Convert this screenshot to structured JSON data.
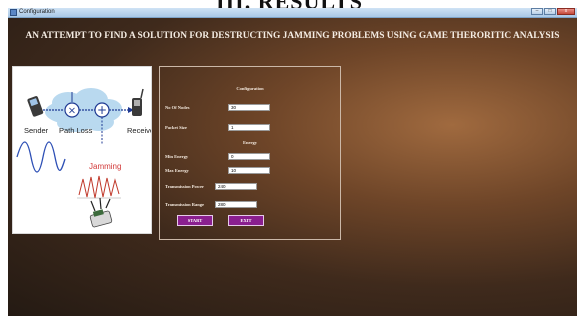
{
  "document": {
    "heading": "III. RESULTS"
  },
  "window": {
    "title": "Configuration",
    "controls": {
      "minimize": "–",
      "maximize": "□",
      "close": "x"
    }
  },
  "app": {
    "title": "AN ATTEMPT TO FIND A SOLUTION FOR DESTRUCTING JAMMING PROBLEMS USING GAME THERORITIC ANALYSIS"
  },
  "diagram": {
    "labels": {
      "sender": "Sender",
      "path_loss": "Path Loss",
      "receiver": "Receiver",
      "jamming": "Jamming"
    },
    "symbols": {
      "multiply": "×",
      "add": "+"
    }
  },
  "configuration": {
    "title": "Configuration",
    "fields": [
      {
        "label": "No Of Nodes",
        "value": "30"
      },
      {
        "label": "Packet Size",
        "value": "1"
      }
    ],
    "energy_title": "Energy",
    "energy_fields": [
      {
        "label": "Min Energy",
        "value": "0"
      },
      {
        "label": "Max Energy",
        "value": "10"
      },
      {
        "label": "Transmission Power",
        "value": "240"
      },
      {
        "label": "Transmission Range",
        "value": "280"
      }
    ],
    "buttons": {
      "start": "START",
      "exit": "EXIT"
    }
  },
  "colors": {
    "background_gradient": [
      "#a06a3f",
      "#241a13"
    ],
    "button_fill": "#8a1f8f",
    "jamming_label": "#d23a3a",
    "sender_wave": "#2d4fb5",
    "jamming_wave": "#c0392b",
    "cloud": "#b9d9ef"
  }
}
